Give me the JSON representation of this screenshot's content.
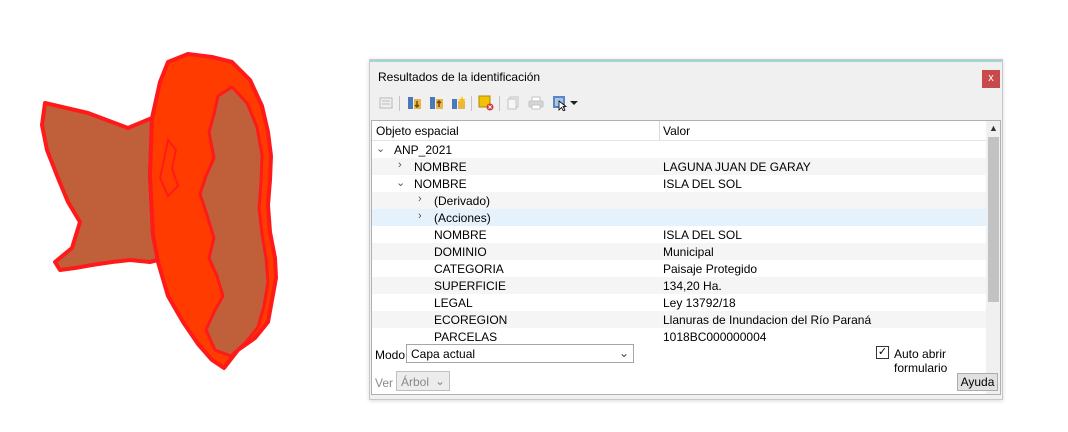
{
  "window": {
    "title": "Resultados de la identificación",
    "close_glyph": "x"
  },
  "toolbar": {
    "icons": [
      "expand-tree-icon",
      "expand-all-icon",
      "collapse-all-icon",
      "expand-new-icon",
      "clear-results-icon",
      "copy-feature-icon",
      "print-icon",
      "identify-mode-icon",
      "dropdown-arrow-icon"
    ]
  },
  "tree": {
    "columns": [
      "Objeto espacial",
      "Valor"
    ],
    "rows": [
      {
        "name": "ANP_2021",
        "value": "",
        "chevron": "⌄"
      },
      {
        "name": "NOMBRE",
        "value": "LAGUNA JUAN DE GARAY",
        "chevron": "›"
      },
      {
        "name": "NOMBRE",
        "value": "ISLA DEL SOL",
        "chevron": "⌄"
      },
      {
        "name": "(Derivado)",
        "value": "",
        "chevron": "›"
      },
      {
        "name": "(Acciones)",
        "value": "",
        "chevron": "›"
      },
      {
        "name": "NOMBRE",
        "value": "ISLA DEL SOL",
        "chevron": ""
      },
      {
        "name": "DOMINIO",
        "value": "Municipal",
        "chevron": ""
      },
      {
        "name": "CATEGORIA",
        "value": "Paisaje Protegido",
        "chevron": ""
      },
      {
        "name": "SUPERFICIE",
        "value": "134,20 Ha.",
        "chevron": ""
      },
      {
        "name": "LEGAL",
        "value": "Ley 13792/18",
        "chevron": ""
      },
      {
        "name": "ECOREGION",
        "value": "Llanuras de Inundacion del Río Paraná",
        "chevron": ""
      },
      {
        "name": "PARCELAS",
        "value": "1018BC000000004",
        "chevron": ""
      }
    ]
  },
  "mode": {
    "label": "Modo",
    "value": "Capa actual"
  },
  "auto_form": {
    "label": "Auto abrir formulario",
    "checked": true,
    "check_glyph": "✓"
  },
  "view": {
    "label": "Ver",
    "value": "Árbol"
  },
  "help": {
    "label": "Ayuda"
  },
  "colors": {
    "highlight": "#ff3b00",
    "polygon_fill": "#c0603a",
    "outline": "#ff1a1a",
    "accent": "#9fd6d6"
  }
}
